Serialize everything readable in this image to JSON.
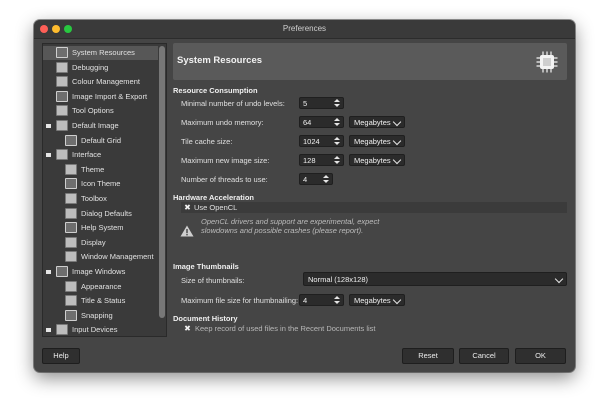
{
  "window": {
    "title": "Preferences"
  },
  "sidebar": {
    "items": [
      {
        "label": "System Resources",
        "icon": "chip-icon",
        "selected": true
      },
      {
        "label": "Debugging",
        "icon": "bug-icon"
      },
      {
        "label": "Colour Management",
        "icon": "palette-icon"
      },
      {
        "label": "Image Import & Export",
        "icon": "image-export-icon"
      },
      {
        "label": "Tool Options",
        "icon": "tool-options-icon"
      },
      {
        "label": "Default Image",
        "icon": "default-image-icon",
        "expanded": true
      },
      {
        "label": "Default Grid",
        "icon": "grid-icon"
      },
      {
        "label": "Interface",
        "icon": "interface-icon",
        "expanded": true
      },
      {
        "label": "Theme",
        "icon": "theme-icon"
      },
      {
        "label": "Icon Theme",
        "icon": "icon-theme-icon"
      },
      {
        "label": "Toolbox",
        "icon": "toolbox-icon"
      },
      {
        "label": "Dialog Defaults",
        "icon": "dialog-defaults-icon"
      },
      {
        "label": "Help System",
        "icon": "help-system-icon"
      },
      {
        "label": "Display",
        "icon": "display-icon"
      },
      {
        "label": "Window Management",
        "icon": "window-management-icon"
      },
      {
        "label": "Image Windows",
        "icon": "image-windows-icon",
        "expanded": true
      },
      {
        "label": "Appearance",
        "icon": "appearance-icon"
      },
      {
        "label": "Title & Status",
        "icon": "title-status-icon"
      },
      {
        "label": "Snapping",
        "icon": "snapping-icon"
      },
      {
        "label": "Input Devices",
        "icon": "input-devices-icon",
        "expanded": true
      }
    ]
  },
  "main": {
    "header_title": "System Resources",
    "resource": {
      "heading": "Resource Consumption",
      "undo_levels_label": "Minimal number of undo levels:",
      "undo_levels_value": "5",
      "undo_memory_label": "Maximum undo memory:",
      "undo_memory_value": "64",
      "undo_memory_unit": "Megabytes",
      "tile_cache_label": "Tile cache size:",
      "tile_cache_value": "1024",
      "tile_cache_unit": "Megabytes",
      "max_image_label": "Maximum new image size:",
      "max_image_value": "128",
      "max_image_unit": "Megabytes",
      "threads_label": "Number of threads to use:",
      "threads_value": "4"
    },
    "hardware": {
      "heading": "Hardware Acceleration",
      "opencl_label": "Use OpenCL",
      "opencl_checked": true,
      "warning": "OpenCL drivers and support are experimental, expect slowdowns and possible crashes (please report)."
    },
    "thumbnails": {
      "heading": "Image Thumbnails",
      "size_label": "Size of thumbnails:",
      "size_value": "Normal (128x128)",
      "max_file_label": "Maximum file size for thumbnailing:",
      "max_file_value": "4",
      "max_file_unit": "Megabytes"
    },
    "history": {
      "heading": "Document History",
      "recent_label": "Keep record of used files in the Recent Documents list",
      "recent_checked": true
    }
  },
  "buttons": {
    "help": "Help",
    "reset": "Reset",
    "cancel": "Cancel",
    "ok": "OK"
  }
}
